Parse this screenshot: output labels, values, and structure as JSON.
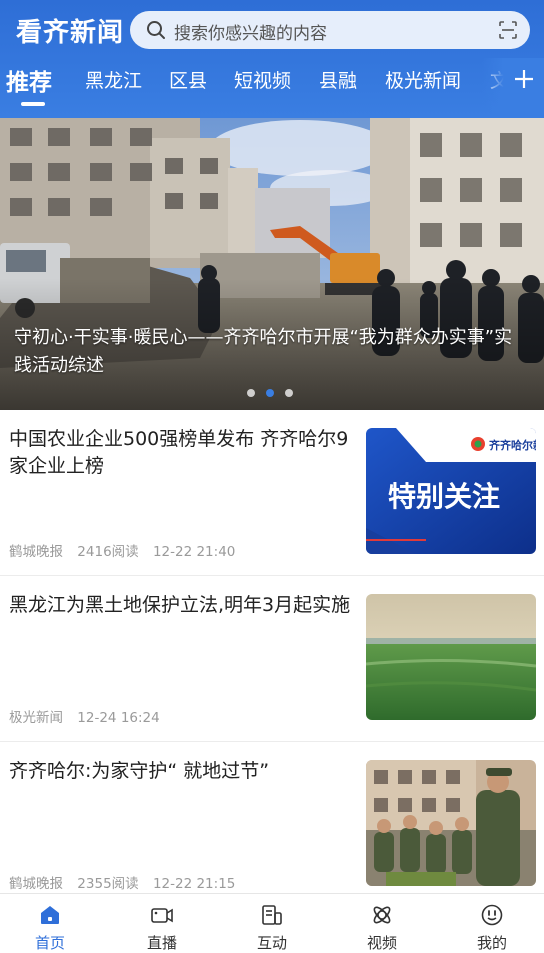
{
  "header": {
    "logo": "看齐新闻",
    "search_placeholder": "搜索你感兴趣的内容",
    "icons": {
      "search": "search-icon",
      "scan": "scan-icon",
      "add": "plus-icon"
    },
    "accent_color": "#3a7ee2"
  },
  "tabs": [
    {
      "label": "推荐",
      "active": true
    },
    {
      "label": "黑龙江",
      "active": false
    },
    {
      "label": "区县",
      "active": false
    },
    {
      "label": "短视频",
      "active": false
    },
    {
      "label": "县融",
      "active": false
    },
    {
      "label": "极光新闻",
      "active": false
    },
    {
      "label": "文",
      "active": false
    }
  ],
  "banner": {
    "title": "守初心·干实事·暖民心——齐齐哈尔市开展“我为群众办实事”实践活动综述",
    "slide_count": 3,
    "active_slide": 2
  },
  "news": [
    {
      "title": "中国农业企业500强榜单发布 齐齐哈尔9家企业上榜",
      "source": "鹤城晚报",
      "reads": "2416阅读",
      "time": "12-22 21:40",
      "thumb": {
        "type": "special-focus",
        "text": "特别关注",
        "brand": "齐齐哈尔新闻网"
      }
    },
    {
      "title": "黑龙江为黑土地保护立法,明年3月起实施",
      "source": "极光新闻",
      "reads": "",
      "time": "12-24 16:24",
      "thumb": {
        "type": "farmland"
      }
    },
    {
      "title": "齐齐哈尔:为家守护“ 就地过节”",
      "source": "鹤城晚报",
      "reads": "2355阅读",
      "time": "12-22 21:15",
      "thumb": {
        "type": "soldiers"
      }
    }
  ],
  "bottom_nav": [
    {
      "label": "首页",
      "icon": "home-icon",
      "active": true
    },
    {
      "label": "直播",
      "icon": "live-camera-icon",
      "active": false
    },
    {
      "label": "互动",
      "icon": "interact-icon",
      "active": false
    },
    {
      "label": "视频",
      "icon": "video-icon",
      "active": false
    },
    {
      "label": "我的",
      "icon": "profile-icon",
      "active": false
    }
  ]
}
